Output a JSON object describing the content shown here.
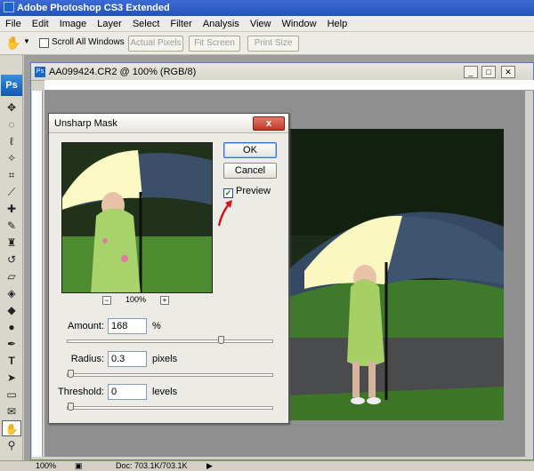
{
  "app": {
    "title": "Adobe Photoshop CS3 Extended"
  },
  "menu": [
    "File",
    "Edit",
    "Image",
    "Layer",
    "Select",
    "Filter",
    "Analysis",
    "View",
    "Window",
    "Help"
  ],
  "options": {
    "scroll_all": "Scroll All Windows",
    "actual_pixels": "Actual Pixels",
    "fit_screen": "Fit Screen",
    "print_size": "Print Size"
  },
  "toolbox": {
    "logo": "Ps"
  },
  "document": {
    "title": "AA099424.CR2 @ 100% (RGB/8)"
  },
  "status": {
    "zoom": "100%",
    "doc": "Doc: 703.1K/703.1K"
  },
  "dialog": {
    "title": "Unsharp Mask",
    "close_label": "x",
    "ok": "OK",
    "cancel": "Cancel",
    "preview_label": "Preview",
    "preview_checked": true,
    "zoom_minus": "−",
    "zoom_level": "100%",
    "zoom_plus": "+",
    "amount_label": "Amount:",
    "amount_value": "168",
    "amount_unit": "%",
    "amount_level": 0.76,
    "radius_label": "Radius:",
    "radius_value": "0.3",
    "radius_unit": "pixels",
    "radius_level": 0.0,
    "threshold_label": "Threshold:",
    "threshold_value": "0",
    "threshold_unit": "levels",
    "threshold_level": 0.0
  },
  "colors": {
    "accent": "#2352b8",
    "annotation": "#d4121b"
  },
  "icons": [
    "hand-tool-icon",
    "move-tool-icon",
    "marquee-tool-icon",
    "lasso-tool-icon",
    "magic-wand-icon",
    "crop-tool-icon",
    "eyedropper-icon",
    "healing-brush-icon",
    "brush-tool-icon",
    "clone-stamp-icon",
    "history-brush-icon",
    "eraser-icon",
    "paint-bucket-icon",
    "blur-tool-icon",
    "dodge-tool-icon",
    "pen-tool-icon",
    "type-tool-icon",
    "path-selection-icon",
    "shape-tool-icon",
    "notes-icon",
    "zoom-tool-icon"
  ]
}
